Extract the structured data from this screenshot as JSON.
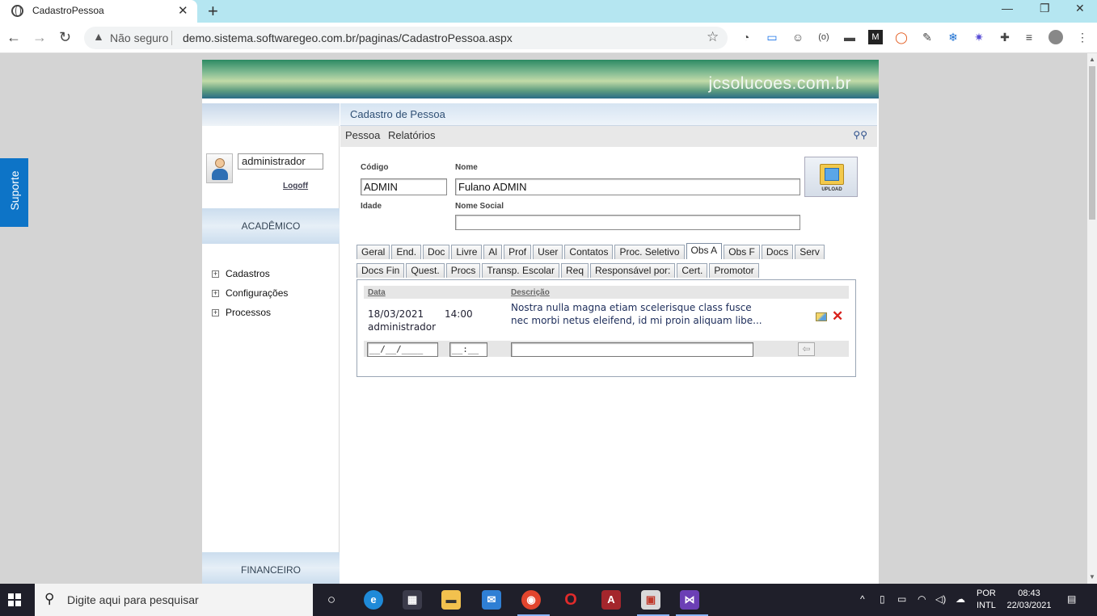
{
  "browser": {
    "tab_title": "CadastroPessoa",
    "insecure_label": "Não seguro",
    "url": "demo.sistema.softwaregeo.com.br/paginas/CadastroPessoa.aspx"
  },
  "side_button": "Suporte",
  "site": {
    "brand": "jcsolucoes.com.br"
  },
  "sidebar": {
    "username": "administrador",
    "logoff": "Logoff",
    "section_top": "ACADÊMICO",
    "items": [
      {
        "label": "Cadastros"
      },
      {
        "label": "Configurações"
      },
      {
        "label": "Processos"
      }
    ],
    "section_bottom": "FINANCEIRO"
  },
  "main": {
    "header": "Cadastro de Pessoa",
    "menu": [
      "Pessoa",
      "Relatórios"
    ],
    "form": {
      "codigo_label": "Código",
      "codigo_value": "ADMIN",
      "nome_label": "Nome",
      "nome_value": "Fulano ADMIN",
      "idade_label": "Idade",
      "nome_social_label": "Nome Social",
      "nome_social_value": "",
      "upload_label": "UPLOAD"
    },
    "tabs_row1": [
      "Geral",
      "End.",
      "Doc",
      "Livre",
      "Al",
      "Prof",
      "User",
      "Contatos",
      "Proc. Seletivo",
      "Obs A",
      "Obs F",
      "Docs",
      "Serv"
    ],
    "tabs_row2": [
      "Docs Fin",
      "Quest.",
      "Procs",
      "Transp. Escolar",
      "Req",
      "Responsável por:",
      "Cert.",
      "Promotor"
    ],
    "active_tab": "Obs A",
    "grid": {
      "col_data": "Data",
      "col_descricao": "Descrição",
      "row": {
        "date": "18/03/2021",
        "time": "14:00",
        "user": "administrador",
        "description": "Nostra nulla magna etiam scelerisque class fusce nec morbi netus eleifend, id mi proin aliquam libe..."
      },
      "new_date_mask": "__/__/____",
      "new_time_mask": "__:__"
    }
  },
  "taskbar": {
    "search_placeholder": "Digite aqui para pesquisar",
    "lang_line1": "POR",
    "lang_line2": "INTL",
    "time": "08:43",
    "date": "22/03/2021"
  }
}
